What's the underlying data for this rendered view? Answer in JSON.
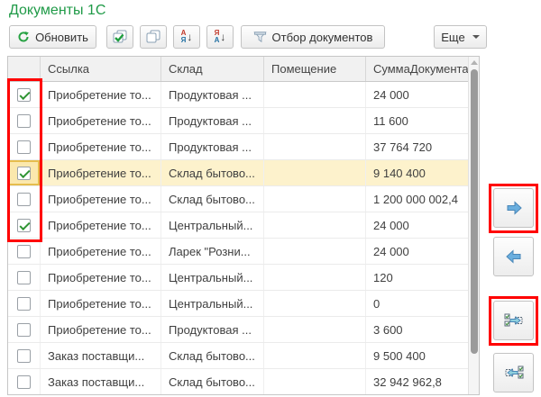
{
  "window": {
    "title": "Документы 1С"
  },
  "toolbar": {
    "refresh": "Обновить",
    "filter": "Отбор документов",
    "more": "Еще",
    "sort_asc": {
      "top": "А",
      "bottom": "Я",
      "arrow": "↓"
    },
    "sort_desc": {
      "top": "Я",
      "bottom": "А",
      "arrow": "↓"
    }
  },
  "table": {
    "columns": {
      "link": "Ссылка",
      "warehouse": "Склад",
      "room": "Помещение",
      "amount": "СуммаДокумента"
    },
    "rows": [
      {
        "checked": true,
        "selected": false,
        "link": "Приобретение то...",
        "warehouse": "Продуктовая ...",
        "room": "",
        "amount": "24 000"
      },
      {
        "checked": false,
        "selected": false,
        "link": "Приобретение то...",
        "warehouse": "Продуктовая ...",
        "room": "",
        "amount": "11 600"
      },
      {
        "checked": false,
        "selected": false,
        "link": "Приобретение то...",
        "warehouse": "Продуктовая ...",
        "room": "",
        "amount": "37 764 720"
      },
      {
        "checked": true,
        "selected": true,
        "link": "Приобретение то...",
        "warehouse": "Склад бытово...",
        "room": "",
        "amount": "9 140 400"
      },
      {
        "checked": false,
        "selected": false,
        "link": "Приобретение то...",
        "warehouse": "Склад бытово...",
        "room": "",
        "amount": "1 200 000 002,4"
      },
      {
        "checked": true,
        "selected": false,
        "link": "Приобретение то...",
        "warehouse": "Центральный...",
        "room": "",
        "amount": "24 000"
      },
      {
        "checked": false,
        "selected": false,
        "link": "Приобретение то...",
        "warehouse": "Ларек \"Розни...",
        "room": "",
        "amount": "24 000"
      },
      {
        "checked": false,
        "selected": false,
        "link": "Приобретение то...",
        "warehouse": "Центральный...",
        "room": "",
        "amount": "120"
      },
      {
        "checked": false,
        "selected": false,
        "link": "Приобретение то...",
        "warehouse": "Центральный...",
        "room": "",
        "amount": "0"
      },
      {
        "checked": false,
        "selected": false,
        "link": "Приобретение то...",
        "warehouse": "Продуктовая ...",
        "room": "",
        "amount": "3 600"
      },
      {
        "checked": false,
        "selected": false,
        "link": "Заказ поставщи...",
        "warehouse": "Склад бытово...",
        "room": "",
        "amount": "9 500 400"
      },
      {
        "checked": false,
        "selected": false,
        "link": "Заказ поставщи...",
        "warehouse": "Склад бытово...",
        "room": "",
        "amount": "32 942 962,8"
      }
    ]
  },
  "icons": {
    "refresh": "refresh-icon",
    "check_all": "check-all-documents-icon",
    "uncheck_all": "uncheck-all-documents-icon",
    "sort_ascending": "sort-ascending-icon",
    "sort_descending": "sort-descending-icon",
    "filter": "funnel-icon",
    "more_caret": "chevron-down-icon",
    "move_right": "arrow-right-icon",
    "move_left": "arrow-left-icon",
    "move_marked_right": "move-marked-right-icon",
    "move_marked_left": "move-marked-left-icon"
  },
  "colors": {
    "title_green": "#1f9a47",
    "check_green": "#2f9433",
    "arrow_blue": "#6aaede",
    "arrow_blue_border": "#4a87b8",
    "selected_row_bg": "#fdf2cc",
    "selected_cell_border": "#e6bd4d",
    "annotation_red": "#ff0000"
  }
}
